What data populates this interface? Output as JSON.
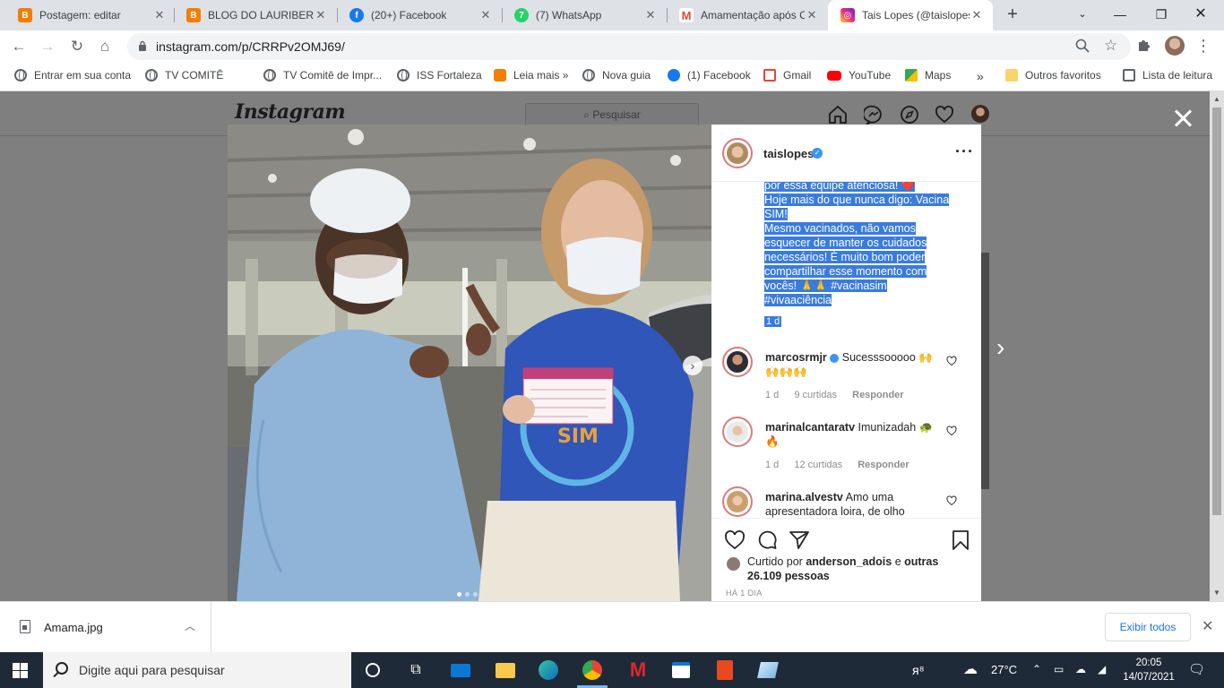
{
  "tabs": [
    {
      "title": "Postagem: editar",
      "favicon": "blogger-icon",
      "color": "#f57d00"
    },
    {
      "title": "BLOG DO LAURIBERTO",
      "favicon": "blogger-icon",
      "color": "#f57d00"
    },
    {
      "title": "(20+) Facebook",
      "favicon": "facebook-icon",
      "color": "#1877f2"
    },
    {
      "title": "(7) WhatsApp",
      "favicon": "whatsapp-icon",
      "color": "#25d366"
    },
    {
      "title": "Amamentação após Co",
      "favicon": "gmail-icon",
      "color": "#ea4335"
    },
    {
      "title": "Tais Lopes (@taislopes",
      "favicon": "instagram-icon",
      "color": "#d62976"
    }
  ],
  "toolbar": {
    "url": "instagram.com/p/CRRPv2OMJ69/"
  },
  "bookmarks": [
    {
      "label": "Entrar em sua conta",
      "icon": "globe-icon"
    },
    {
      "label": "TV COMITÊ",
      "icon": "globe-icon"
    },
    {
      "label": "TV Comitê de Impr...",
      "icon": "globe-icon"
    },
    {
      "label": "ISS Fortaleza",
      "icon": "globe-icon"
    },
    {
      "label": "Leia mais »",
      "icon": "blogger-icon"
    },
    {
      "label": "Nova guia",
      "icon": "globe-icon"
    },
    {
      "label": "(1) Facebook",
      "icon": "facebook-icon"
    },
    {
      "label": "Gmail",
      "icon": "gmail-icon"
    },
    {
      "label": "YouTube",
      "icon": "youtube-icon"
    },
    {
      "label": "Maps",
      "icon": "maps-icon"
    },
    {
      "label": "»",
      "icon": ""
    },
    {
      "label": "Outros favoritos",
      "icon": "folder-icon"
    },
    {
      "label": "Lista de leitura",
      "icon": "reading-list-icon"
    }
  ],
  "instagram": {
    "logo": "Instagram",
    "search_placeholder": "Pesquisar"
  },
  "post": {
    "author": "taislopes",
    "caption_lines": [
      "por essa equipe atenciosa! ❤️",
      "Hoje mais do que nunca digo: Vacina",
      "SIM!",
      "Mesmo vacinados, não vamos",
      "esquecer de manter os cuidados",
      "necessários! É muito bom poder",
      "compartilhar esse momento com",
      "vocês! 🙏🙏 #vacinasim",
      "#vivaaciência"
    ],
    "caption_time": "1 d",
    "comments": [
      {
        "user": "marcosrmjr",
        "verified": true,
        "text": "Sucesssooooo 🙌🙌🙌🙌",
        "time": "1 d",
        "likes": "9 curtidas",
        "reply": "Responder"
      },
      {
        "user": "marinalcantaratv",
        "verified": false,
        "text": "Imunizadah 🐢🔥",
        "time": "1 d",
        "likes": "12 curtidas",
        "reply": "Responder"
      },
      {
        "user": "marina.alvestv",
        "verified": false,
        "text": "Amo uma apresentadora loira, de olho",
        "time": "",
        "likes": "",
        "reply": ""
      }
    ],
    "liked_prefix": "Curtido por",
    "liked_user": "anderson_adois",
    "liked_conj": "e",
    "liked_rest": "outras 26.109 pessoas",
    "date": "HÁ 1 DIA"
  },
  "downloads": {
    "file": "Amama.jpg",
    "show_all": "Exibir todos"
  },
  "taskbar": {
    "search_placeholder": "Digite aqui para pesquisar",
    "temperature": "27°C",
    "time": "20:05",
    "date": "14/07/2021"
  }
}
